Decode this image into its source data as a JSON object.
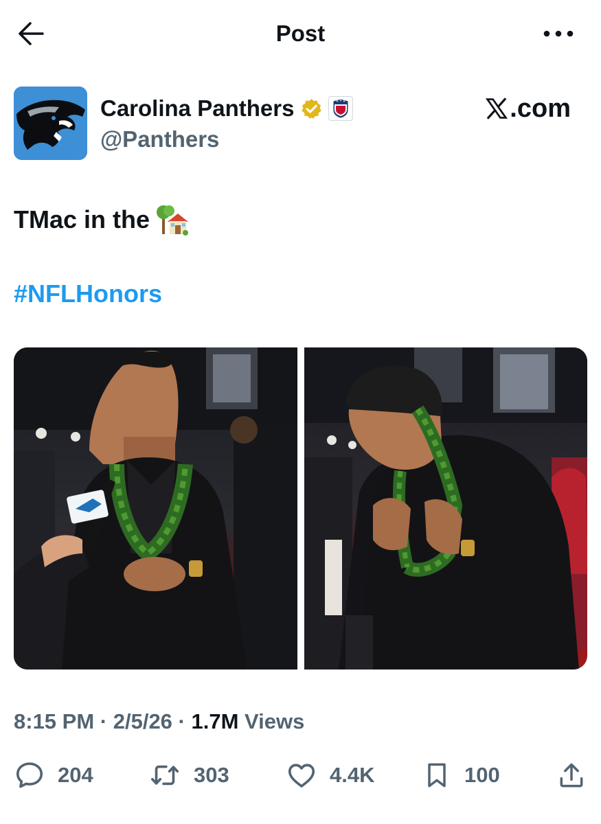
{
  "header": {
    "title": "Post",
    "back_icon": "arrow-left-icon",
    "more_icon": "more-horizontal-icon"
  },
  "author": {
    "name": "Carolina Panthers",
    "handle": "@Panthers",
    "avatar_color": "#3d8fd6",
    "verified_color": "#e2b719",
    "affiliate_badge_icon": "nfl-shield-icon"
  },
  "source": {
    "label": ".com",
    "logo_icon": "x-logo-icon"
  },
  "post": {
    "text": "TMac in the",
    "emoji_icon": "house-with-tree-emoji-icon",
    "hashtag": "#NFLHonors",
    "hashtag_color": "#1d9bf0"
  },
  "media": [
    {
      "icon": "photo-player-smiling-interview"
    },
    {
      "icon": "photo-player-adjusting-lei"
    }
  ],
  "meta": {
    "time": "8:15 PM",
    "separator": " · ",
    "date": "2/5/26",
    "views_count": "1.7M",
    "views_label": "Views"
  },
  "actions": {
    "replies": "204",
    "reposts": "303",
    "likes": "4.4K",
    "bookmarks": "100"
  }
}
